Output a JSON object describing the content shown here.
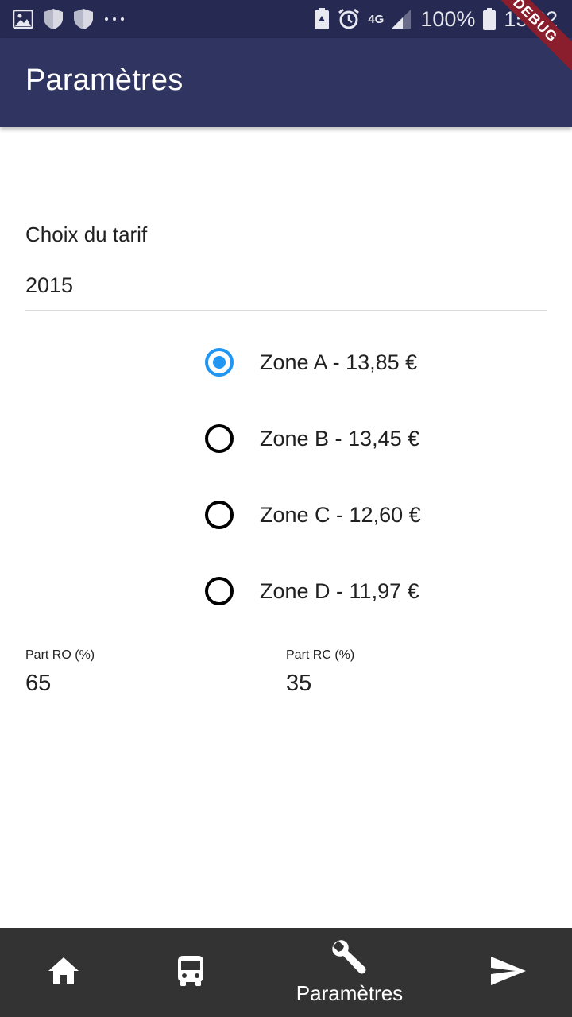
{
  "status_bar": {
    "network": "4G",
    "battery": "100%",
    "time": "15:02"
  },
  "app_bar": {
    "title": "Paramètres",
    "debug_banner": "DEBUG"
  },
  "tarif": {
    "label": "Choix du tarif",
    "value": "2015"
  },
  "zones": [
    {
      "label": "Zone A - 13,85 €",
      "selected": true
    },
    {
      "label": "Zone B - 13,45 €",
      "selected": false
    },
    {
      "label": "Zone C - 12,60 €",
      "selected": false
    },
    {
      "label": "Zone D - 11,97 €",
      "selected": false
    }
  ],
  "parts": {
    "ro": {
      "label": "Part RO (%)",
      "value": "65"
    },
    "rc": {
      "label": "Part RC (%)",
      "value": "35"
    }
  },
  "bottom_nav": {
    "items": [
      {
        "icon": "home-icon"
      },
      {
        "icon": "bus-icon"
      },
      {
        "icon": "wrench-icon",
        "label": "Paramètres",
        "active": true
      },
      {
        "icon": "send-icon"
      }
    ]
  },
  "colors": {
    "status_bar": "#262a52",
    "app_bar": "#2f3460",
    "radio_selected": "#2196f3",
    "bottom_nav": "#333333"
  }
}
